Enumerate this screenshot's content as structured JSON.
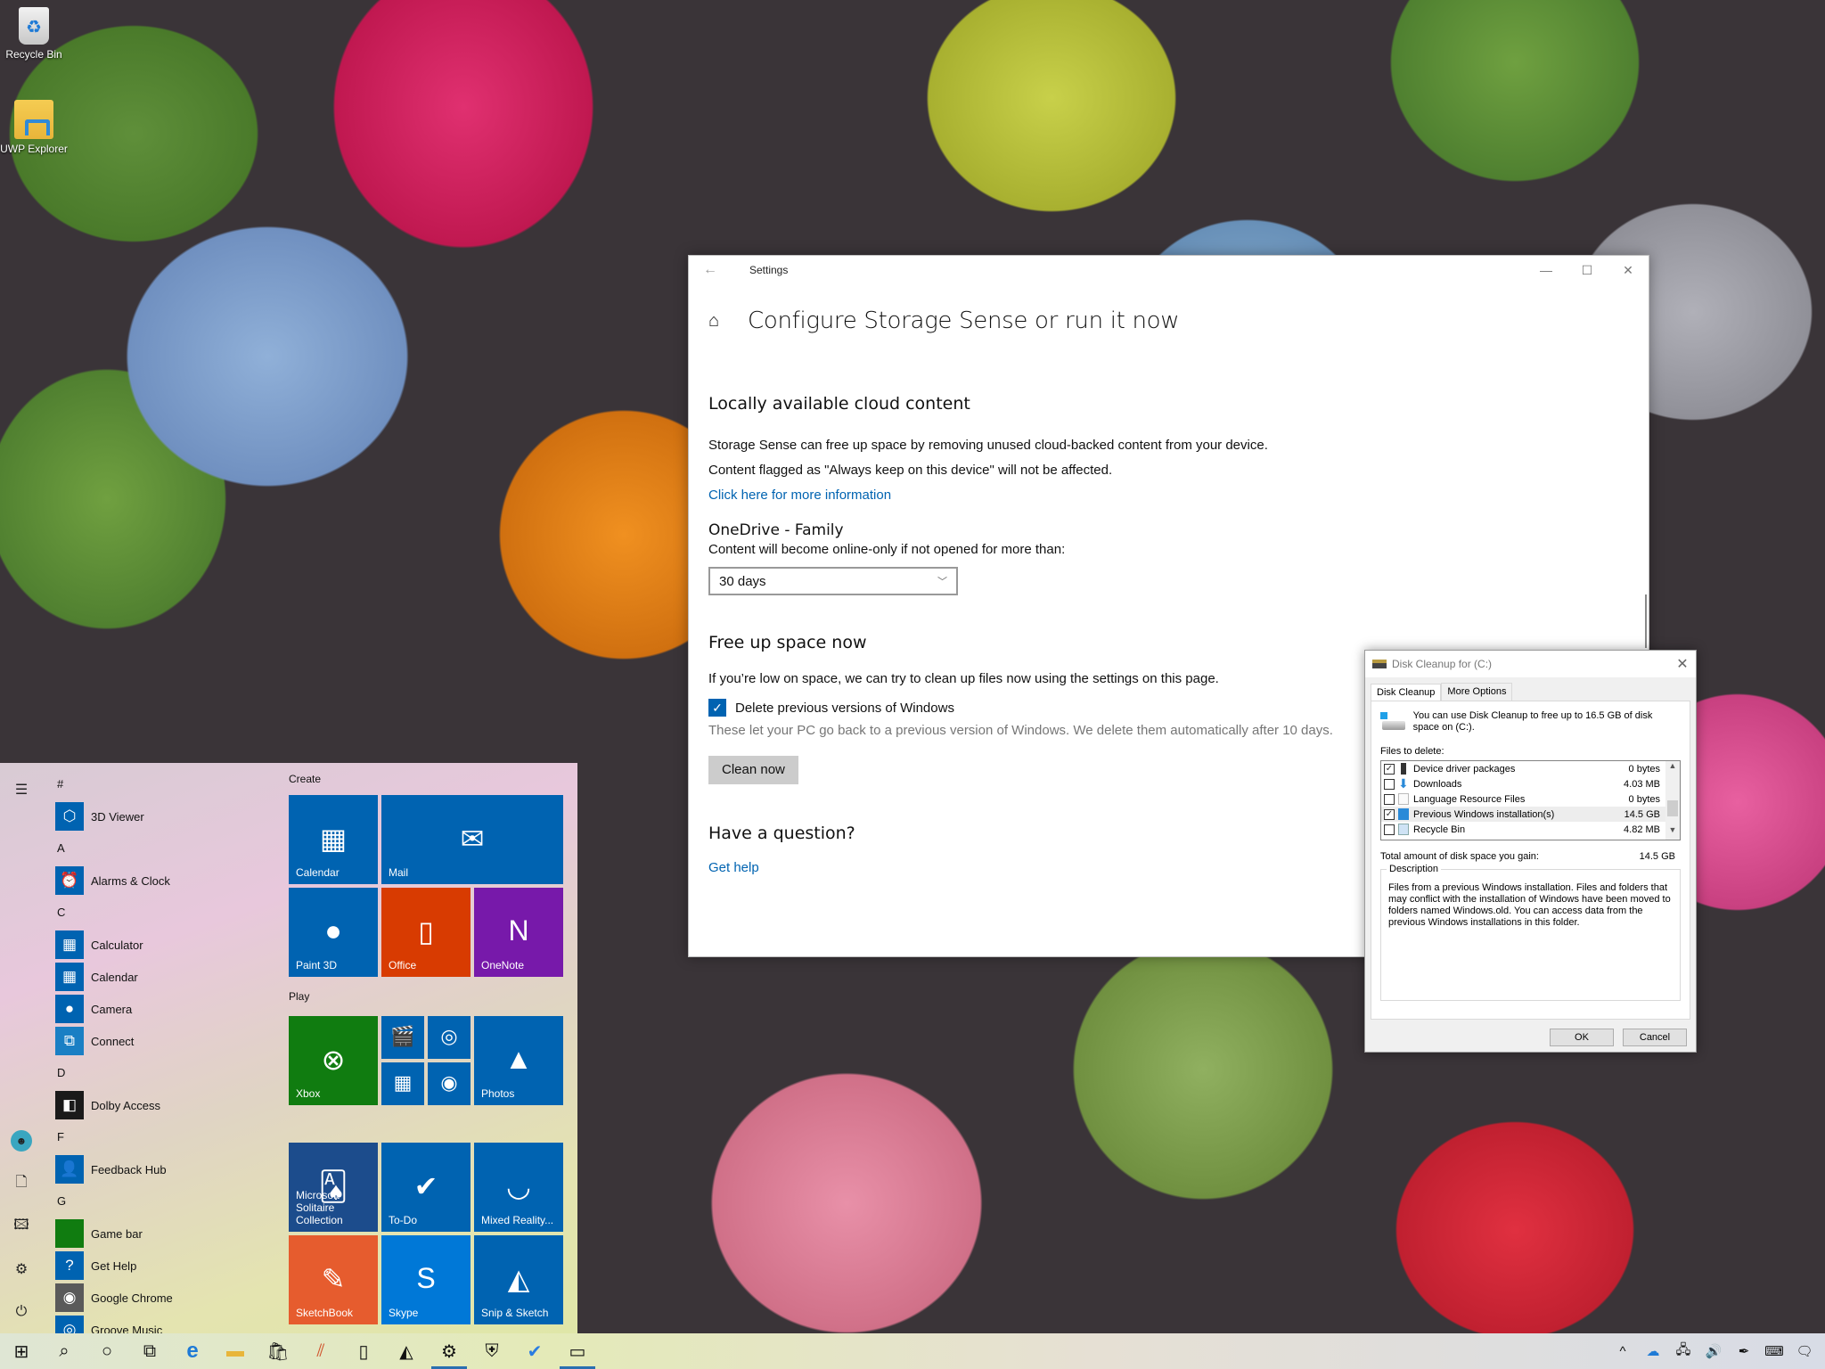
{
  "desktop": {
    "icons": [
      {
        "label": "Recycle Bin",
        "icon": "recycle-bin-icon"
      },
      {
        "label": "UWP Explorer",
        "icon": "folder-icon"
      }
    ]
  },
  "settings": {
    "window_title": "Settings",
    "page_title": "Configure Storage Sense or run it now",
    "cloud": {
      "heading": "Locally available cloud content",
      "p1": "Storage Sense can free up space by removing unused cloud-backed content from your device.",
      "p2": "Content flagged as \"Always keep on this device\" will not be affected.",
      "link": "Click here for more information",
      "account": "OneDrive - Family",
      "dropdown_label": "Content will become online-only if not opened for more than:",
      "dropdown_value": "30 days"
    },
    "free": {
      "heading": "Free up space now",
      "desc": "If you’re low on space, we can try to clean up files now using the settings on this page.",
      "checkbox_label": "Delete previous versions of Windows",
      "checkbox_checked": true,
      "note": "These let your PC go back to a previous version of Windows. We delete them automatically after 10 days.",
      "button": "Clean now"
    },
    "help": {
      "heading": "Have a question?",
      "link": "Get help"
    },
    "controls": {
      "minimize": "—",
      "maximize": "☐",
      "close": "✕"
    },
    "accent": "#0063b1"
  },
  "disk_cleanup": {
    "title": "Disk Cleanup for  (C:)",
    "tabs": [
      {
        "label": "Disk Cleanup",
        "active": true
      },
      {
        "label": "More Options",
        "active": false
      }
    ],
    "intro": "You can use Disk Cleanup to free up to 16.5 GB of disk space on  (C:).",
    "files_label": "Files to delete:",
    "files": [
      {
        "name": "Device driver packages",
        "size": "0 bytes",
        "checked": true
      },
      {
        "name": "Downloads",
        "size": "4.03 MB",
        "checked": false
      },
      {
        "name": "Language Resource Files",
        "size": "0 bytes",
        "checked": false
      },
      {
        "name": "Previous Windows installation(s)",
        "size": "14.5 GB",
        "checked": true,
        "selected": true
      },
      {
        "name": "Recycle Bin",
        "size": "4.82 MB",
        "checked": false
      }
    ],
    "total_label": "Total amount of disk space you gain:",
    "total_value": "14.5 GB",
    "description_legend": "Description",
    "description": "Files from a previous Windows installation.  Files and folders that may conflict with the installation of Windows have been moved to folders named Windows.old.  You can access data from the previous Windows installations in this folder.",
    "ok": "OK",
    "cancel": "Cancel"
  },
  "start_menu": {
    "app_list": [
      {
        "type": "letter",
        "text": "#"
      },
      {
        "type": "app",
        "name": "3D Viewer",
        "color": "#0063b1",
        "glyph": "⬡"
      },
      {
        "type": "letter",
        "text": "A"
      },
      {
        "type": "app",
        "name": "Alarms & Clock",
        "color": "#0063b1",
        "glyph": "⏰"
      },
      {
        "type": "letter",
        "text": "C"
      },
      {
        "type": "app",
        "name": "Calculator",
        "color": "#0063b1",
        "glyph": "▦"
      },
      {
        "type": "app",
        "name": "Calendar",
        "color": "#0063b1",
        "glyph": "▦"
      },
      {
        "type": "app",
        "name": "Camera",
        "color": "#0063b1",
        "glyph": "●"
      },
      {
        "type": "app",
        "name": "Connect",
        "color": "#1a7fc4",
        "glyph": "⧉"
      },
      {
        "type": "letter",
        "text": "D"
      },
      {
        "type": "app",
        "name": "Dolby Access",
        "color": "#1a1a1a",
        "glyph": "◧"
      },
      {
        "type": "letter",
        "text": "F"
      },
      {
        "type": "app",
        "name": "Feedback Hub",
        "color": "#0063b1",
        "glyph": "👤"
      },
      {
        "type": "letter",
        "text": "G"
      },
      {
        "type": "app",
        "name": "Game bar",
        "color": "#107c10",
        "glyph": ""
      },
      {
        "type": "app",
        "name": "Get Help",
        "color": "#0063b1",
        "glyph": "?"
      },
      {
        "type": "app",
        "name": "Google Chrome",
        "color": "#5a5a5a",
        "glyph": "◉"
      },
      {
        "type": "app",
        "name": "Groove Music",
        "color": "#0063b1",
        "glyph": "◎"
      }
    ],
    "groups": [
      {
        "label": "Create"
      },
      {
        "label": "Play"
      }
    ],
    "tiles": [
      {
        "name": "Calendar",
        "color": "#0063b1",
        "glyph": "▦"
      },
      {
        "name": "Mail",
        "color": "#0063b1",
        "glyph": "✉"
      },
      {
        "name": "Paint 3D",
        "color": "#0063b1",
        "glyph": "●"
      },
      {
        "name": "Office",
        "color": "#d83b01",
        "glyph": "▯"
      },
      {
        "name": "OneNote",
        "color": "#7719aa",
        "glyph": "N"
      },
      {
        "name": "Xbox",
        "color": "#107c10",
        "glyph": "⊗"
      },
      {
        "name": "",
        "color": "#0063b1",
        "glyph": "🎬"
      },
      {
        "name": "",
        "color": "#0063b1",
        "glyph": "◎"
      },
      {
        "name": "",
        "color": "#0063b1",
        "glyph": "▦"
      },
      {
        "name": "",
        "color": "#0063b1",
        "glyph": "◉"
      },
      {
        "name": "Photos",
        "color": "#0063b1",
        "glyph": "▲"
      },
      {
        "name": "Microsoft Solitaire Collection",
        "color": "#1c4c8c",
        "glyph": "🂡"
      },
      {
        "name": "To-Do",
        "color": "#0063b1",
        "glyph": "✔"
      },
      {
        "name": "Mixed Reality...",
        "color": "#0063b1",
        "glyph": "◡"
      },
      {
        "name": "SketchBook",
        "color": "#e65c2e",
        "glyph": "✎"
      },
      {
        "name": "Skype",
        "color": "#0078d7",
        "glyph": "S"
      },
      {
        "name": "Snip & Sketch",
        "color": "#0063b1",
        "glyph": "◭"
      }
    ]
  },
  "taskbar": {
    "items": [
      {
        "name": "start",
        "glyph": "⊞",
        "active": false
      },
      {
        "name": "search",
        "glyph": "⌕",
        "active": false
      },
      {
        "name": "cortana",
        "glyph": "○",
        "active": false
      },
      {
        "name": "task-view",
        "glyph": "⧉",
        "active": false
      },
      {
        "name": "edge",
        "glyph": "e",
        "active": false
      },
      {
        "name": "file-explorer",
        "glyph": "▬",
        "active": false
      },
      {
        "name": "store",
        "glyph": "🛍",
        "active": false
      },
      {
        "name": "app-stripes",
        "glyph": "⫽",
        "active": false
      },
      {
        "name": "phone",
        "glyph": "▯",
        "active": false
      },
      {
        "name": "photos",
        "glyph": "◭",
        "active": false
      },
      {
        "name": "settings",
        "glyph": "⚙",
        "active": true
      },
      {
        "name": "security",
        "glyph": "⛨",
        "active": false
      },
      {
        "name": "to-do",
        "glyph": "✔",
        "active": false
      },
      {
        "name": "disk-cleanup",
        "glyph": "▭",
        "active": true
      }
    ],
    "tray": [
      {
        "name": "show-hidden",
        "glyph": "^"
      },
      {
        "name": "onedrive",
        "glyph": "☁"
      },
      {
        "name": "network",
        "glyph": "🖧"
      },
      {
        "name": "volume",
        "glyph": "🔊"
      },
      {
        "name": "pen",
        "glyph": "✒"
      },
      {
        "name": "touch-keyboard",
        "glyph": "⌨"
      },
      {
        "name": "action-center",
        "glyph": "🗨"
      }
    ]
  }
}
